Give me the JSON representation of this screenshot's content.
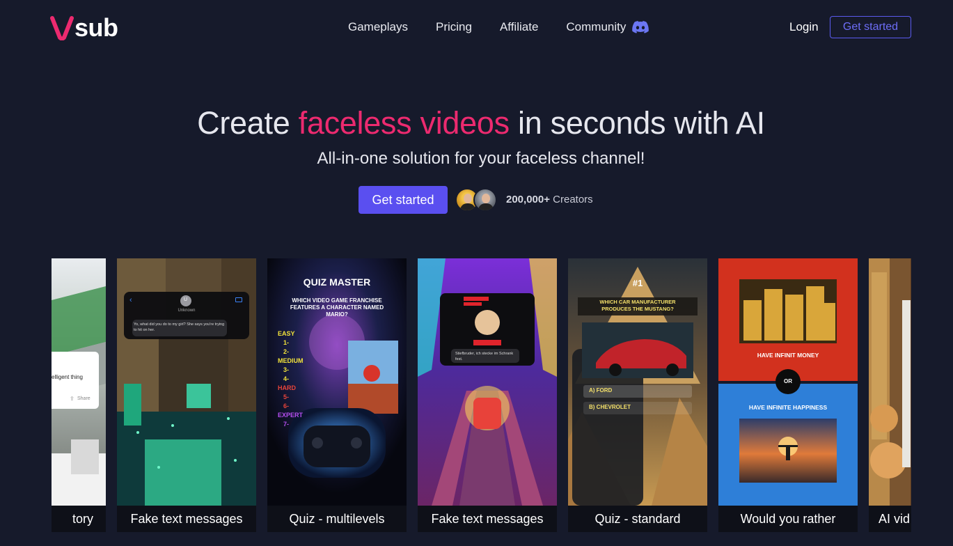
{
  "brand": {
    "logo_text": "sub",
    "accent": "#ec2a6f",
    "primary": "#5a4ff0"
  },
  "nav": {
    "links": [
      "Gameplays",
      "Pricing",
      "Affiliate",
      "Community"
    ],
    "login": "Login",
    "cta": "Get started"
  },
  "hero": {
    "title_pre": "Create ",
    "title_accent": "faceless videos",
    "title_post": " in seconds with AI",
    "subtitle": "All-in-one solution for your faceless channel!",
    "cta": "Get started",
    "creators_count": "200,000+",
    "creators_label": "Creators"
  },
  "cards": [
    {
      "label": "tory",
      "content": {
        "snippet": "elligent thing",
        "share": "Share"
      }
    },
    {
      "label": "Fake text messages",
      "content": {
        "avatar_initial": "U",
        "contact": "Unknown",
        "message": "Yo, what did you do to my girl? She says you're trying to hit on her."
      }
    },
    {
      "label": "Quiz - multilevels",
      "content": {
        "title": "QUIZ MASTER",
        "question": "WHICH VIDEO GAME FRANCHISE FEATURES A CHARACTER NAMED MARIO?",
        "levels": [
          {
            "name": "EASY",
            "color": "#f2e23a"
          },
          {
            "name": "1-",
            "color": "#f2e23a"
          },
          {
            "name": "2-",
            "color": "#f2e23a"
          },
          {
            "name": "MEDIUM",
            "color": "#f2e23a"
          },
          {
            "name": "3-",
            "color": "#f2e23a"
          },
          {
            "name": "4-",
            "color": "#f2e23a"
          },
          {
            "name": "HARD",
            "color": "#e8443a"
          },
          {
            "name": "5-",
            "color": "#e8443a"
          },
          {
            "name": "6-",
            "color": "#e8443a"
          },
          {
            "name": "EXPERT",
            "color": "#b54ef0"
          },
          {
            "name": "7-",
            "color": "#b54ef0"
          }
        ]
      }
    },
    {
      "label": "Fake text messages",
      "content": {
        "message": "Stiefbruder, ich stecke im Schrank fest."
      }
    },
    {
      "label": "Quiz - standard",
      "content": {
        "rank": "#1",
        "question": "WHICH CAR MANUFACTURER PRODUCES THE MUSTANG?",
        "options": [
          "A) FORD",
          "B) CHEVROLET"
        ]
      }
    },
    {
      "label": "Would you rather",
      "content": {
        "top": "HAVE INFINIT MONEY",
        "or": "OR",
        "bottom": "HAVE INFINITE HAPPINESS"
      }
    },
    {
      "label": "AI vid",
      "content": {}
    }
  ]
}
